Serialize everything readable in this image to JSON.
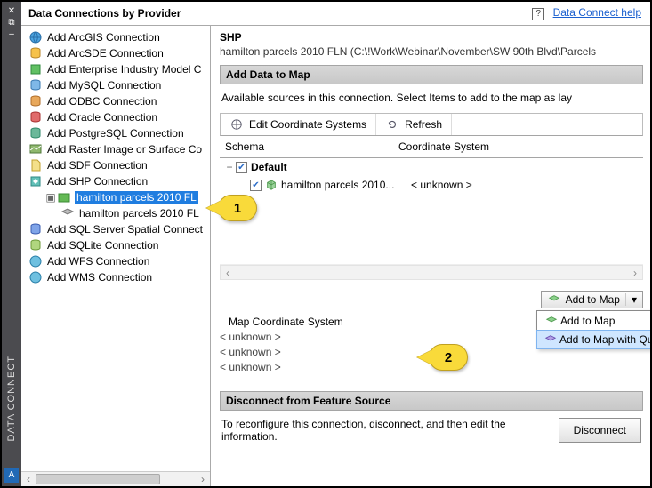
{
  "sidebar_title": "DATA CONNECT",
  "header": {
    "title": "Data Connections by Provider",
    "help_link": "Data Connect help"
  },
  "tree": [
    {
      "label": "Add ArcGIS Connection",
      "icon": "arcgis"
    },
    {
      "label": "Add ArcSDE Connection",
      "icon": "arcsde"
    },
    {
      "label": "Add Enterprise Industry Model C",
      "icon": "enterprise"
    },
    {
      "label": "Add MySQL Connection",
      "icon": "mysql"
    },
    {
      "label": "Add ODBC Connection",
      "icon": "odbc"
    },
    {
      "label": "Add Oracle Connection",
      "icon": "oracle"
    },
    {
      "label": "Add PostgreSQL Connection",
      "icon": "postgres"
    },
    {
      "label": "Add Raster Image or Surface Co",
      "icon": "raster"
    },
    {
      "label": "Add SDF Connection",
      "icon": "sdf"
    },
    {
      "label": "Add SHP Connection",
      "icon": "shp"
    },
    {
      "label": "hamilton parcels 2010 FL",
      "icon": "folder",
      "indent": 1,
      "selected": true,
      "collapsible": true
    },
    {
      "label": "hamilton parcels 2010 FL",
      "icon": "layer",
      "indent": 2
    },
    {
      "label": "Add SQL Server Spatial Connect",
      "icon": "sqlserver"
    },
    {
      "label": "Add SQLite Connection",
      "icon": "sqlite"
    },
    {
      "label": "Add WFS Connection",
      "icon": "wfs"
    },
    {
      "label": "Add WMS Connection",
      "icon": "wms"
    }
  ],
  "right": {
    "title": "SHP",
    "path": "hamilton parcels 2010 FLN (C:\\!Work\\Webinar\\November\\SW 90th Blvd\\Parcels",
    "section_add": "Add Data to Map",
    "available_text": "Available sources in this connection.  Select Items to add to the map as lay",
    "toolbar": {
      "edit": "Edit Coordinate Systems",
      "refresh": "Refresh"
    },
    "schema_header": {
      "schema": "Schema",
      "coord": "Coordinate System"
    },
    "schema_rows": {
      "default_label": "Default",
      "item_label": "hamilton parcels 2010...",
      "item_coord": "< unknown >"
    },
    "add_button": "Add to Map",
    "dropdown": {
      "add": "Add to Map",
      "add_query": "Add to Map with Query"
    },
    "mcs": {
      "label": "Map Coordinate System",
      "values": [
        "< unknown >",
        "< unknown >",
        "< unknown >"
      ]
    },
    "disconnect_header": "Disconnect from Feature Source",
    "disconnect_text": "To reconfigure this connection, disconnect, and then edit the information.",
    "disconnect_button": "Disconnect"
  },
  "callouts": {
    "one": "1",
    "two": "2"
  }
}
